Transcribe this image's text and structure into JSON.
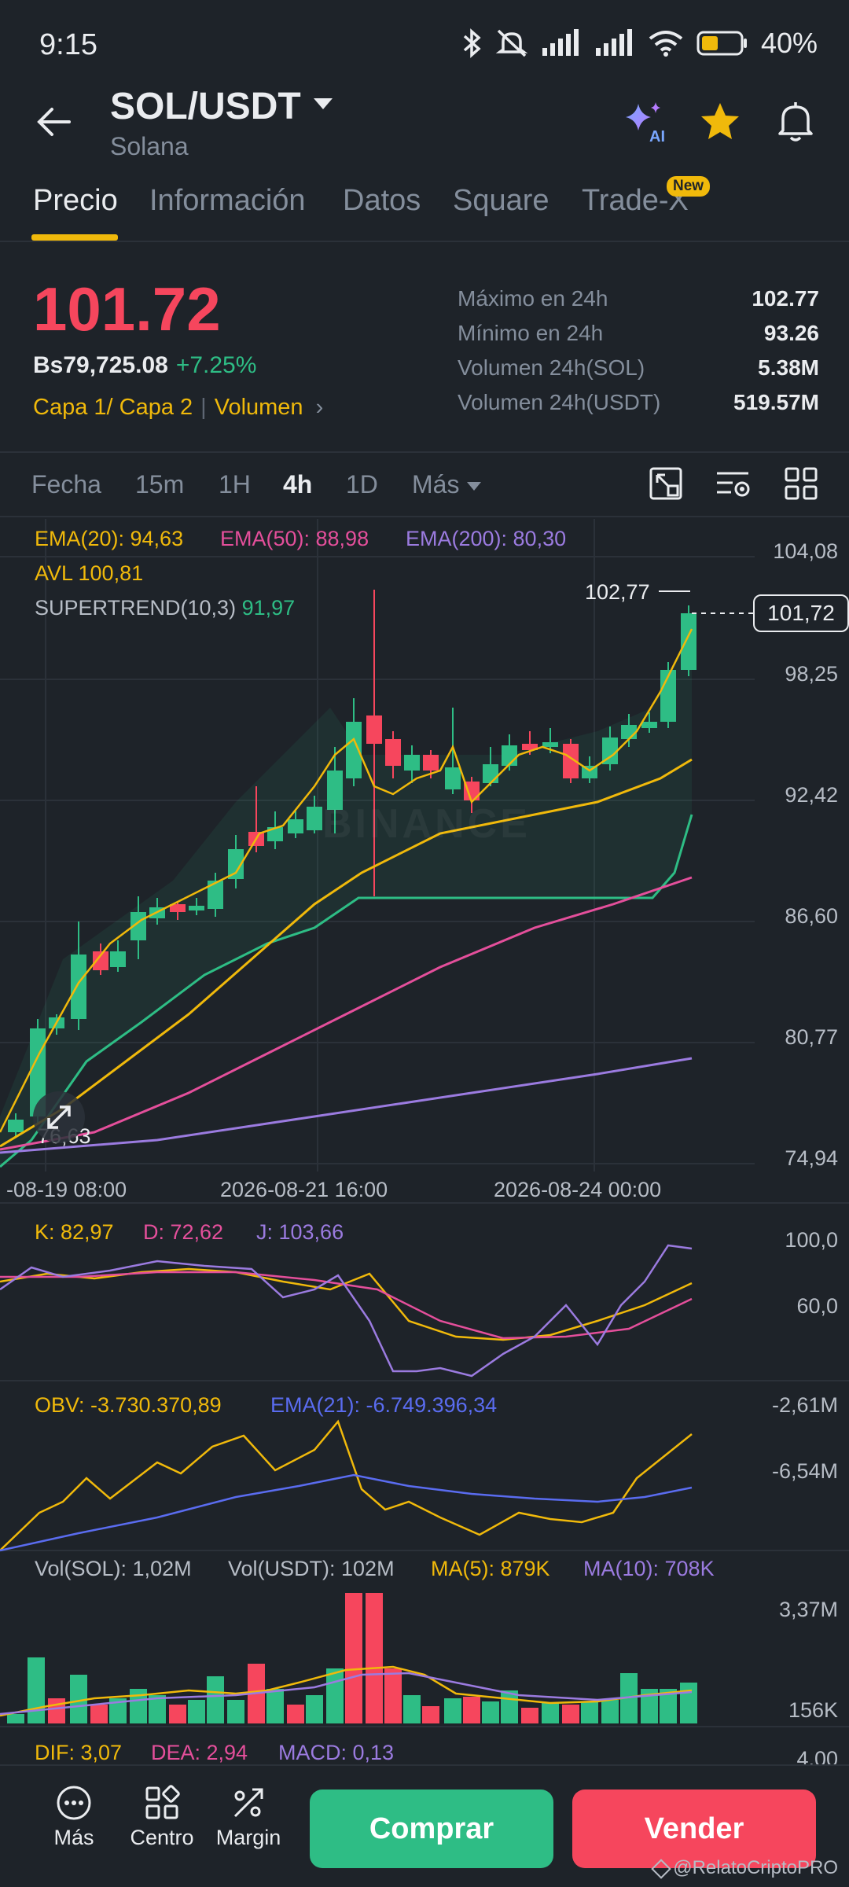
{
  "status_bar": {
    "time": "9:15",
    "battery": "40%"
  },
  "header": {
    "pair": "SOL/USDT",
    "name": "Solana"
  },
  "tabs": [
    {
      "label": "Precio"
    },
    {
      "label": "Información"
    },
    {
      "label": "Datos"
    },
    {
      "label": "Square"
    },
    {
      "label": "Trade-X"
    }
  ],
  "new_badge": "New",
  "price": {
    "last": "101.72",
    "fiat": "Bs79,725.08",
    "change": "+7.25%",
    "layers_label": "Capa 1/ Capa 2",
    "volume_link": "Volumen"
  },
  "stats": [
    {
      "label": "Máximo en 24h",
      "value": "102.77"
    },
    {
      "label": "Mínimo en 24h",
      "value": "93.26"
    },
    {
      "label": "Volumen 24h(SOL)",
      "value": "5.38M"
    },
    {
      "label": "Volumen 24h(USDT)",
      "value": "519.57M"
    }
  ],
  "timeframes": [
    {
      "label": "Fecha"
    },
    {
      "label": "15m"
    },
    {
      "label": "1H"
    },
    {
      "label": "4h"
    },
    {
      "label": "1D"
    },
    {
      "label": "Más"
    }
  ],
  "indicators": {
    "ema20": "EMA(20): 94,63",
    "ema50": "EMA(50): 88,98",
    "ema200": "EMA(200): 80,30",
    "avl": "AVL 100,81",
    "supertrend_label": "SUPERTREND(10,3)",
    "supertrend_value": "91,97"
  },
  "main_chart": {
    "y_ticks": [
      "104,08",
      "98,25",
      "92,42",
      "86,60",
      "80,77",
      "74,94"
    ],
    "x_ticks": [
      "-08-19 08:00",
      "2026-08-21 16:00",
      "2026-08-24 00:00"
    ],
    "high_label": "102,77",
    "low_label": "76,63",
    "last_price_box": "101,72",
    "watermark": "BINANCE"
  },
  "kdj": {
    "k": "K: 82,97",
    "d": "D: 72,62",
    "j": "J: 103,66",
    "y_ticks": [
      "100,0",
      "60,0"
    ]
  },
  "obv": {
    "obv": "OBV: -3.730.370,89",
    "ema": "EMA(21): -6.749.396,34",
    "y_ticks": [
      "-2,61M",
      "-6,54M"
    ]
  },
  "volume": {
    "vol_sol": "Vol(SOL): 1,02M",
    "vol_usdt": "Vol(USDT): 102M",
    "ma5": "MA(5): 879K",
    "ma10": "MA(10): 708K",
    "y_ticks": [
      "3,37M",
      "156K"
    ]
  },
  "macd": {
    "dif": "DIF: 3,07",
    "dea": "DEA: 2,94",
    "macd": "MACD: 0,13",
    "y_tick": "4,00"
  },
  "bottom_bar": {
    "more": "Más",
    "center": "Centro",
    "margin": "Margin",
    "buy": "Comprar",
    "sell": "Vender"
  },
  "watermark": "@RelatoCriptoPRO",
  "colors": {
    "green": "#2ebd85",
    "red": "#f6465d",
    "yellow": "#f0b90b",
    "pink": "#e44f9b",
    "purple": "#9b7be0",
    "blue": "#5a6cf0"
  }
}
